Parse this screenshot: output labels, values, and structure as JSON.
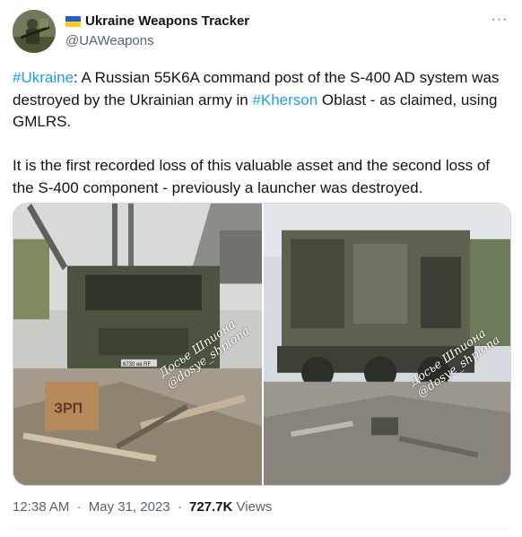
{
  "author": {
    "display_name": "Ukraine Weapons Tracker",
    "handle": "@UAWeapons",
    "flag_icon": "ukraine-flag-icon",
    "avatar_icon": "avatar"
  },
  "more_icon": "more-options-icon",
  "tweet": {
    "hashtag_ukraine": "#Ukraine",
    "part1": ": A Russian 55K6A command post of the S-400 AD system was destroyed by the Ukrainian army in ",
    "hashtag_kherson": "#Kherson",
    "part2": " Oblast - as claimed, using GMLRS.",
    "paragraph2": "It is the first recorded loss of this valuable asset and the second loss of the S-400 component - previously a launcher was destroyed."
  },
  "media": {
    "watermark_line1": "Досье Шпиона",
    "watermark_line2": "@dosye_shpiona",
    "box_label": "ЗРП",
    "plate": "6730 ев RF"
  },
  "meta": {
    "time": "12:38 AM",
    "separator": "·",
    "date": "May 31, 2023",
    "views_count": "727.7K",
    "views_label": "Views"
  },
  "colors": {
    "link": "#1d9bf0",
    "secondary_text": "#536471",
    "primary_text": "#0f1419"
  }
}
